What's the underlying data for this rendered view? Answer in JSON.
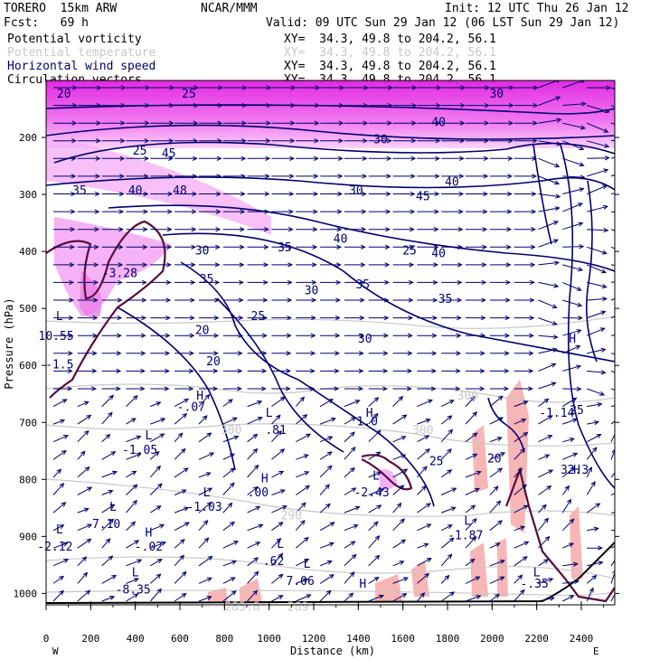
{
  "header": {
    "model": "TORERO  15km ARW",
    "org": "NCAR/MMM",
    "init": "Init: 12 UTC Thu 26 Jan 12",
    "fcst": "Fcst:   69 h",
    "valid": "Valid: 09 UTC Sun 29 Jan 12 (06 LST Sun 29 Jan 12)"
  },
  "legend": [
    {
      "label": "Potential vorticity",
      "color": "#000000",
      "xy": "XY=  34.3, 49.8 to 204.2, 56.1"
    },
    {
      "label": "Potential temperature",
      "color": "#c8c8c8",
      "xy": "XY=  34.3, 49.8 to 204.2, 56.1"
    },
    {
      "label": "Horizontal wind speed",
      "color": "#00006e",
      "xy": "XY=  34.3, 49.8 to 204.2, 56.1"
    },
    {
      "label": "Circulation vectors",
      "color": "#000000",
      "xy": "XY=  34.3, 49.8 to 204.2, 56.1"
    }
  ],
  "chart_data": {
    "type": "cross-section",
    "xlabel": "Distance (km)",
    "ylabel": "Pressure (hPa)",
    "xlim": [
      0,
      2550
    ],
    "ylim": [
      1020,
      100
    ],
    "x_ticks": [
      0,
      200,
      400,
      600,
      800,
      1000,
      1200,
      1400,
      1600,
      1800,
      2000,
      2200,
      2400
    ],
    "y_ticks": [
      200,
      300,
      400,
      500,
      600,
      700,
      800,
      900,
      1000
    ],
    "endpoints": {
      "left": "W",
      "right": "E"
    },
    "colors": {
      "wind": "#00006e",
      "pv_fill": "#e040e0",
      "pv_line": "#5a0a3a",
      "theta": "#c8c8c8",
      "shade_low": "#f7a8a8"
    },
    "wind_speed_labels": [
      {
        "text": "40",
        "x": 1320,
        "p": 385
      },
      {
        "text": "40",
        "x": 1760,
        "p": 410
      },
      {
        "text": "35",
        "x": 1070,
        "p": 400
      },
      {
        "text": "35",
        "x": 1420,
        "p": 465
      },
      {
        "text": "35",
        "x": 1790,
        "p": 490
      },
      {
        "text": "35",
        "x": 720,
        "p": 455
      },
      {
        "text": "35",
        "x": 150,
        "p": 300
      },
      {
        "text": "30",
        "x": 700,
        "p": 405
      },
      {
        "text": "30",
        "x": 1190,
        "p": 475
      },
      {
        "text": "30",
        "x": 1430,
        "p": 560
      },
      {
        "text": "45",
        "x": 1690,
        "p": 310
      },
      {
        "text": "25",
        "x": 950,
        "p": 520
      },
      {
        "text": "25",
        "x": 1750,
        "p": 775
      },
      {
        "text": "20",
        "x": 700,
        "p": 545
      },
      {
        "text": "20",
        "x": 750,
        "p": 600
      },
      {
        "text": "25",
        "x": 2380,
        "p": 685
      },
      {
        "text": "32.3",
        "x": 2370,
        "p": 790
      },
      {
        "text": "20",
        "x": 2010,
        "p": 770
      }
    ],
    "pv_labels": [
      {
        "text": "-3.28",
        "x": 330,
        "p": 445
      },
      {
        "text": "-1.5",
        "x": 60,
        "p": 605
      },
      {
        "text": "10.55",
        "x": 45,
        "p": 555
      },
      {
        "text": "L",
        "x": 60,
        "p": 520
      },
      {
        "text": "H",
        "x": 690,
        "p": 660
      },
      {
        "text": "-.07",
        "x": 650,
        "p": 680
      },
      {
        "text": ".81",
        "x": 1030,
        "p": 720
      },
      {
        "text": "L",
        "x": 1000,
        "p": 690
      },
      {
        "text": "L",
        "x": 460,
        "p": 730
      },
      {
        "text": "-1.05",
        "x": 420,
        "p": 755
      },
      {
        "text": "H",
        "x": 980,
        "p": 805
      },
      {
        "text": ".00",
        "x": 950,
        "p": 830
      },
      {
        "text": "L",
        "x": 720,
        "p": 830
      },
      {
        "text": "-1.03",
        "x": 710,
        "p": 855
      },
      {
        "text": "L",
        "x": 300,
        "p": 855
      },
      {
        "text": "7.10",
        "x": 270,
        "p": 885
      },
      {
        "text": "H",
        "x": 460,
        "p": 900
      },
      {
        "text": "-.02",
        "x": 460,
        "p": 925
      },
      {
        "text": "L",
        "x": 60,
        "p": 895
      },
      {
        "text": "-2.12",
        "x": 40,
        "p": 925
      },
      {
        "text": "L",
        "x": 1480,
        "p": 800
      },
      {
        "text": "-2.43",
        "x": 1460,
        "p": 830
      },
      {
        "text": "H",
        "x": 1450,
        "p": 690
      },
      {
        "text": "1.0",
        "x": 1440,
        "p": 705
      },
      {
        "text": "L",
        "x": 1890,
        "p": 880
      },
      {
        "text": "-1.87",
        "x": 1880,
        "p": 905
      },
      {
        "text": "L",
        "x": 1050,
        "p": 920
      },
      {
        "text": ".62",
        "x": 1020,
        "p": 950
      },
      {
        "text": "L",
        "x": 1170,
        "p": 955
      },
      {
        "text": "7.06",
        "x": 1140,
        "p": 985
      },
      {
        "text": "L",
        "x": 400,
        "p": 970
      },
      {
        "text": "-8.35",
        "x": 390,
        "p": 1000
      },
      {
        "text": "H",
        "x": 1420,
        "p": 990
      },
      {
        "text": "L",
        "x": 2200,
        "p": 970
      },
      {
        "text": "-.35",
        "x": 2190,
        "p": 990
      },
      {
        "text": "-1.14",
        "x": 2290,
        "p": 690
      },
      {
        "text": "H",
        "x": 2360,
        "p": 560
      },
      {
        "text": "H",
        "x": 2380,
        "p": 790
      }
    ],
    "theta_labels": [
      {
        "text": "300",
        "x": 1690,
        "p": 720
      },
      {
        "text": "300",
        "x": 1890,
        "p": 660
      },
      {
        "text": "290",
        "x": 1100,
        "p": 870
      },
      {
        "text": "285.8",
        "x": 880,
        "p": 1030
      },
      {
        "text": "289",
        "x": 1130,
        "p": 1030
      },
      {
        "text": "300",
        "x": 830,
        "p": 720
      }
    ],
    "upper_pv_labels": [
      {
        "text": "20",
        "x": 80,
        "p": 130
      },
      {
        "text": "25",
        "x": 640,
        "p": 130
      },
      {
        "text": "25",
        "x": 420,
        "p": 230
      },
      {
        "text": "30",
        "x": 1500,
        "p": 210
      },
      {
        "text": "30",
        "x": 1390,
        "p": 300
      },
      {
        "text": "45",
        "x": 550,
        "p": 235
      },
      {
        "text": "40",
        "x": 400,
        "p": 300
      },
      {
        "text": "48",
        "x": 600,
        "p": 300
      },
      {
        "text": "30",
        "x": 2020,
        "p": 130
      },
      {
        "text": "40",
        "x": 1760,
        "p": 180
      },
      {
        "text": "40",
        "x": 1820,
        "p": 285
      },
      {
        "text": "25",
        "x": 1630,
        "p": 405
      }
    ]
  }
}
